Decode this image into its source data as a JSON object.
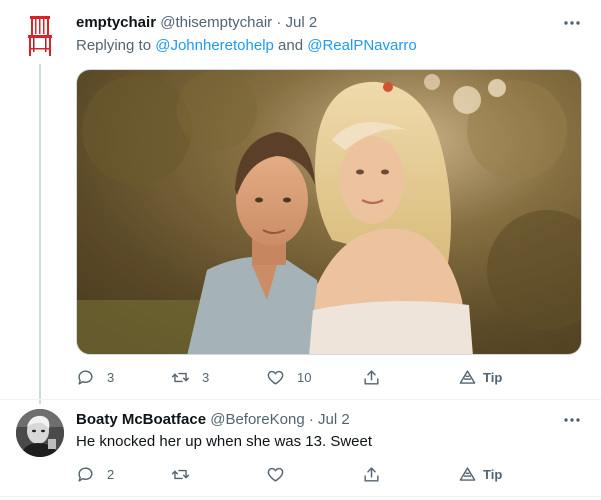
{
  "tweet1": {
    "display_name": "emptychair",
    "handle": "@thisemptychair",
    "separator": "·",
    "date": "Jul 2",
    "replying_prefix": "Replying to",
    "mention1": "@Johnheretohelp",
    "and_word": "and",
    "mention2": "@RealPNavarro",
    "media_icon": "photo-of-couple",
    "stats": {
      "replies": "3",
      "retweets": "3",
      "likes": "10",
      "tip_label": "Tip"
    }
  },
  "tweet2": {
    "display_name": "Boaty McBoatface",
    "handle": "@BeforeKong",
    "separator": "·",
    "date": "Jul 2",
    "text": "He knocked her up when she was 13. Sweet",
    "stats": {
      "replies": "2",
      "retweets": "",
      "likes": "",
      "tip_label": "Tip"
    }
  },
  "colors": {
    "accent": "#1d9bf0",
    "secondary_text": "#536471",
    "chair_red": "#d8232a"
  }
}
